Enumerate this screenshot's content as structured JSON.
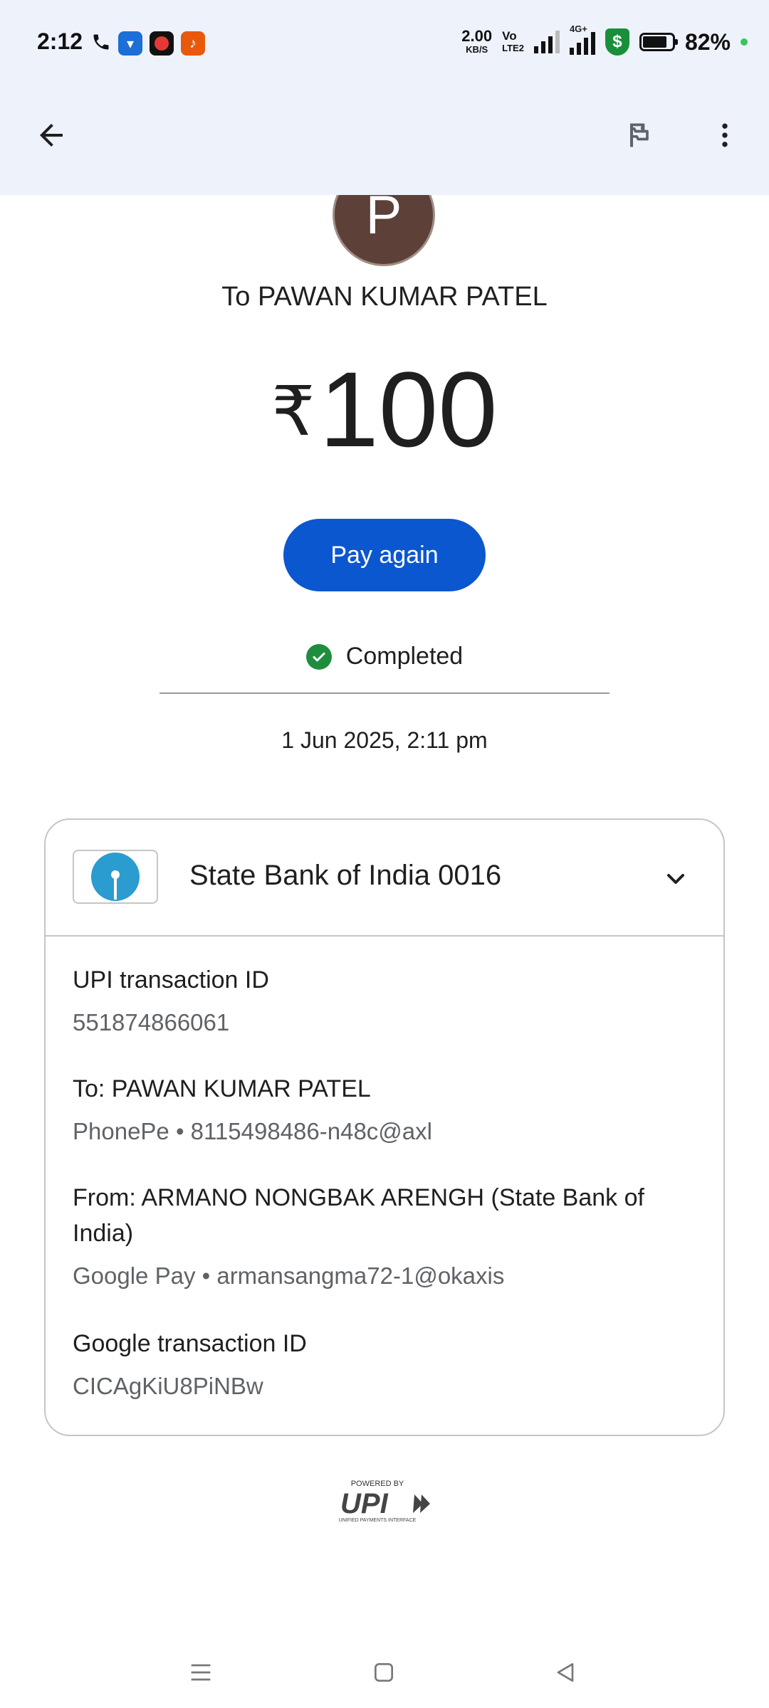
{
  "status_bar": {
    "time": "2:12",
    "net_speed_value": "2.00",
    "net_speed_unit": "KB/S",
    "volte_line1": "Vo",
    "volte_line2": "LTE2",
    "network_type": "4G+",
    "battery_percent": "82%",
    "battery_level": 0.82,
    "notification_icons": [
      "phone-icon",
      "app-notification-icon",
      "media-app-icon",
      "live-app-icon"
    ]
  },
  "app_bar": {
    "back_icon": "arrow-left-icon",
    "report_icon": "flag-icon",
    "more_icon": "more-vert-icon"
  },
  "transaction": {
    "avatar_letter": "P",
    "recipient": "To PAWAN KUMAR PATEL",
    "currency": "₹",
    "amount": "100",
    "pay_again_label": "Pay again",
    "status": "Completed",
    "datetime": "1 Jun 2025, 2:11 pm"
  },
  "details_card": {
    "bank_name": "State Bank of India 0016",
    "items": [
      {
        "label": "UPI transaction ID",
        "value": "551874866061"
      },
      {
        "label": "To: PAWAN KUMAR PATEL",
        "value": "PhonePe • 8115498486-n48c@axl"
      },
      {
        "label": "From: ARMANO NONGBAK ARENGH (State Bank of India)",
        "value": "Google Pay • armansangma72-1@okaxis"
      },
      {
        "label": "Google transaction ID",
        "value": "CICAgKiU8PiNBw"
      }
    ]
  },
  "footer": {
    "powered_by": "POWERED BY",
    "upi_text": "UPI",
    "upi_subtitle": "UNIFIED PAYMENTS INTERFACE"
  },
  "colors": {
    "app_bar_bg": "#eef2fb",
    "primary_button": "#0b57d0",
    "success_green": "#1e8e3e",
    "avatar_bg": "#5d4037",
    "sbi_blue": "#2b9ccf"
  }
}
